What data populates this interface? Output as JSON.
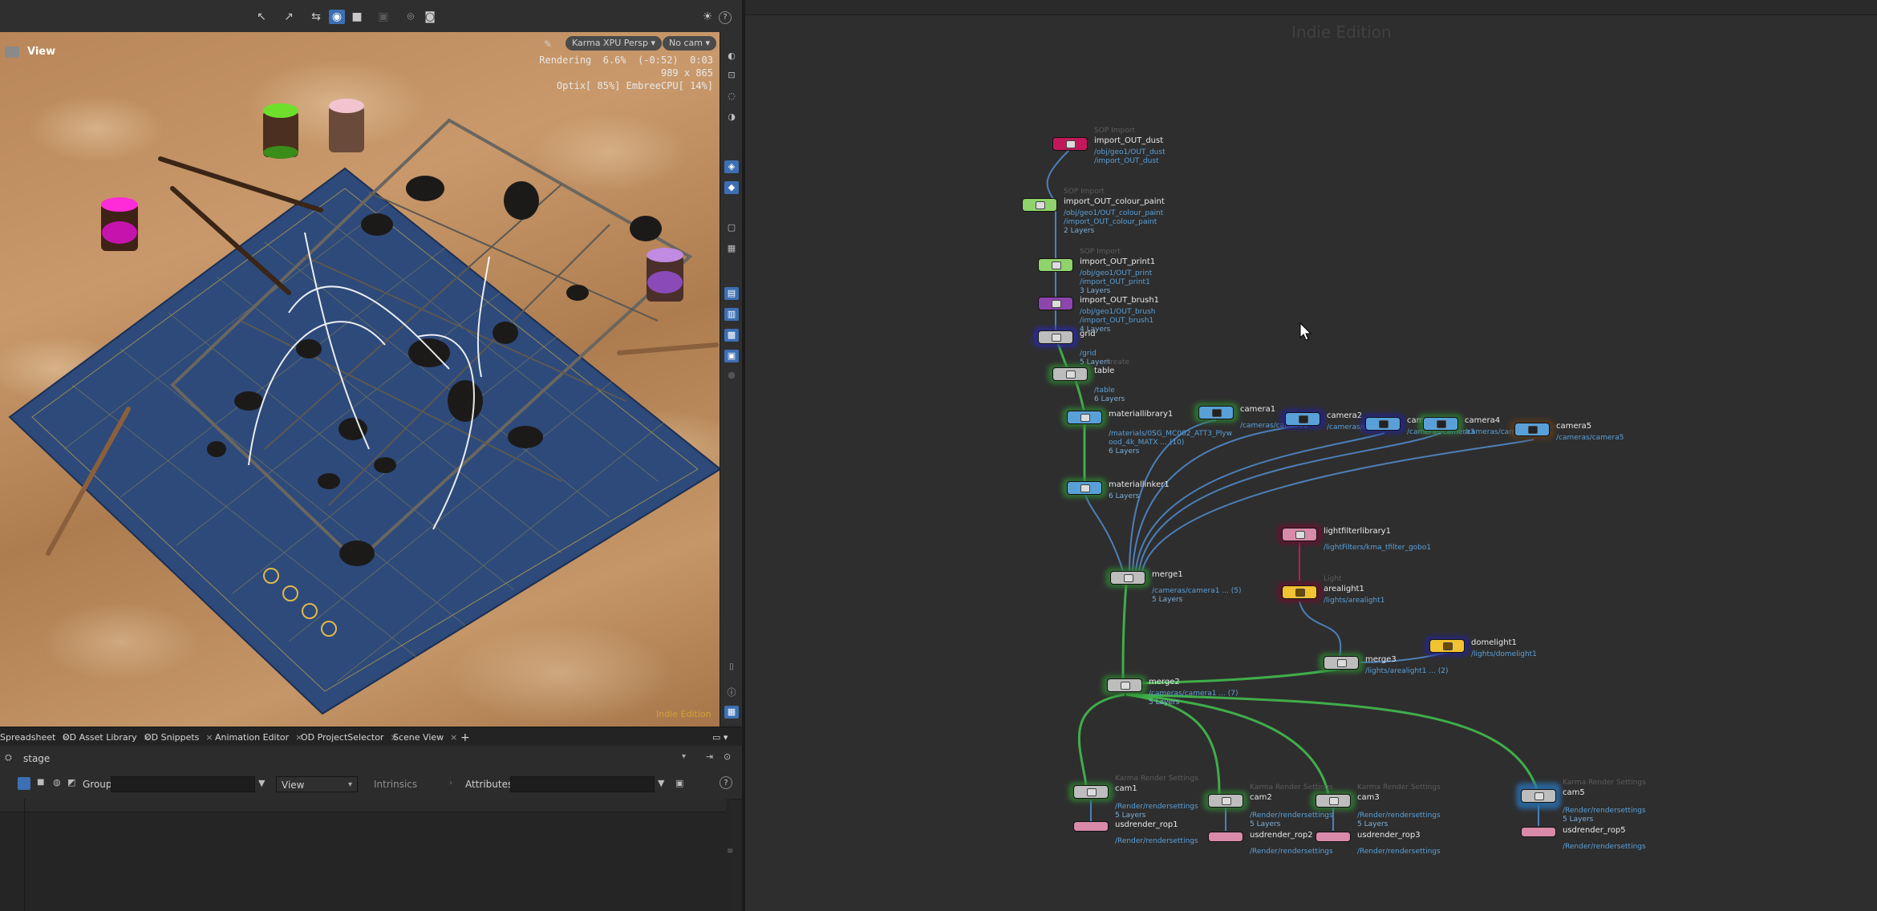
{
  "viewport": {
    "title": "View",
    "renderer": "Karma XPU Persp",
    "camera": "No cam",
    "render_status": "Rendering  6.6%  (-0:52)  0:03",
    "resolution": "989 x 865",
    "device_usage": "Optix[ 85%] EmbreeCPU[ 14%]",
    "watermark": "Indie Edition"
  },
  "tabs": [
    "Spreadsheet",
    "OD Asset Library",
    "OD Snippets",
    "Animation Editor",
    "OD ProjectSelector",
    "Scene View"
  ],
  "add_tab": "+",
  "path": {
    "value": "stage"
  },
  "filters": {
    "group_label": "Group:",
    "view_label": "View",
    "intrinsics_label": "Intrinsics",
    "attributes_label": "Attributes:",
    "help": "?"
  },
  "network": {
    "watermark": "Indie Edition",
    "nodes": {
      "import_out_dust": {
        "type": "SOP Import",
        "name": "import_OUT_dust",
        "info": [
          "/obj/geo1/OUT_dust",
          "/import_OUT_dust"
        ]
      },
      "import_out_colour_paint": {
        "type": "SOP Import",
        "name": "import_OUT_colour_paint",
        "info": [
          "/obj/geo1/OUT_colour_paint",
          "/import_OUT_colour_paint"
        ],
        "layers": "2 Layers"
      },
      "import_out_print1": {
        "type": "SOP Import",
        "name": "import_OUT_print1",
        "info": [
          "/obj/geo1/OUT_print",
          "/import_OUT_print1"
        ],
        "layers": "3 Layers"
      },
      "import_out_brush1": {
        "name": "import_OUT_brush1",
        "info": [
          "/obj/geo1/OUT_brush",
          "/import_OUT_brush1"
        ],
        "layers": "4 Layers"
      },
      "grid": {
        "name": "grid",
        "info": [
          "/grid"
        ],
        "layers": "5 Layers"
      },
      "table": {
        "type": "Create",
        "name": "table",
        "info": [
          "/table"
        ],
        "layers": "6 Layers"
      },
      "materiallibrary1": {
        "name": "materiallibrary1",
        "info": [
          "/materials/0SG_MC002_ATT3_Plyw",
          "ood_4k_MATX ... (10)"
        ],
        "layers": "6 Layers"
      },
      "materiallinker1": {
        "name": "materiallinker1",
        "layers": "6 Layers"
      },
      "camera1": {
        "name": "camera1",
        "info": [
          "/cameras/camera1"
        ]
      },
      "camera2": {
        "name": "camera2",
        "info": [
          "/cameras/camera2"
        ]
      },
      "camera3": {
        "name": "camera3",
        "info": [
          "/cameras/camera3"
        ]
      },
      "camera4": {
        "name": "camera4",
        "info": [
          "/cameras/camera4"
        ]
      },
      "camera5": {
        "name": "camera5",
        "info": [
          "/cameras/camera5"
        ]
      },
      "merge1": {
        "name": "merge1",
        "info": [
          "/cameras/camera1 ... (5)"
        ],
        "layers": "5 Layers"
      },
      "lightfilterlibrary1": {
        "name": "lightfilterlibrary1",
        "info": [
          "/lightFilters/kma_tfilter_gobo1"
        ]
      },
      "arealight1": {
        "type": "Light",
        "name": "arealight1",
        "info": [
          "/lights/arealight1"
        ]
      },
      "domelight1": {
        "name": "domelight1",
        "info": [
          "/lights/domelight1"
        ]
      },
      "merge3": {
        "name": "merge3",
        "info": [
          "/lights/arealight1 ... (2)"
        ]
      },
      "merge2": {
        "name": "merge2",
        "info": [
          "/cameras/camera1 ... (7)"
        ],
        "layers": "5 Layers"
      },
      "cam1": {
        "type": "Karma Render Settings",
        "name": "cam1",
        "info": [
          "/Render/rendersettings"
        ],
        "layers": "5 Layers"
      },
      "cam2": {
        "type": "Karma Render Settings",
        "name": "cam2",
        "info": [
          "/Render/rendersettings"
        ],
        "layers": "5 Layers"
      },
      "cam3": {
        "type": "Karma Render Settings",
        "name": "cam3",
        "info": [
          "/Render/rendersettings"
        ],
        "layers": "5 Layers"
      },
      "cam5": {
        "type": "Karma Render Settings",
        "name": "cam5",
        "info": [
          "/Render/rendersettings"
        ],
        "layers": "5 Layers"
      },
      "usdrender_rop1": {
        "name": "usdrender_rop1",
        "info": [
          "/Render/rendersettings"
        ]
      },
      "usdrender_rop2": {
        "name": "usdrender_rop2",
        "info": [
          "/Render/rendersettings"
        ]
      },
      "usdrender_rop3": {
        "name": "usdrender_rop3",
        "info": [
          "/Render/rendersettings"
        ]
      },
      "usdrender_rop5": {
        "name": "usdrender_rop5",
        "info": [
          "/Render/rendersettings"
        ]
      }
    }
  },
  "colors": {
    "selection_accent": "#3d6fb3",
    "wire_green": "#3fae4a",
    "wire_blue": "#4d7fb8",
    "node_magenta": "#c2185b",
    "node_lightgreen": "#8fd36b",
    "node_purple": "#8e44ad",
    "node_yellow": "#f1c232",
    "node_pink": "#d88aa8",
    "node_cyan": "#5aa0d8"
  }
}
